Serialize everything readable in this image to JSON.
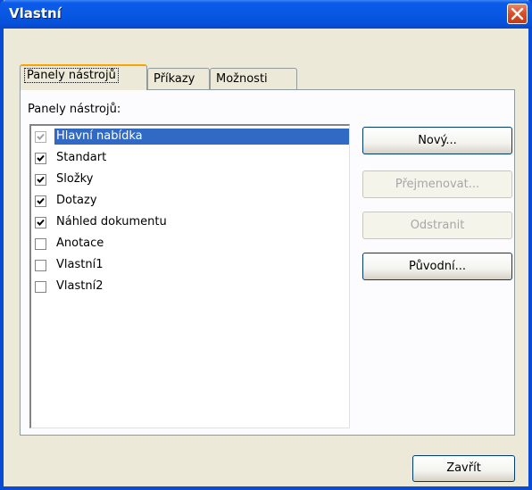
{
  "window": {
    "title": "Vlastní"
  },
  "tabs": [
    {
      "label": "Panely nástrojů",
      "active": true
    },
    {
      "label": "Příkazy",
      "active": false
    },
    {
      "label": "Možnosti",
      "active": false
    }
  ],
  "toolbars": {
    "label": "Panely nástrojů:",
    "items": [
      {
        "label": "Hlavní nabídka",
        "checked": true,
        "disabled": true,
        "selected": true
      },
      {
        "label": "Standart",
        "checked": true
      },
      {
        "label": "Složky",
        "checked": true
      },
      {
        "label": "Dotazy",
        "checked": true
      },
      {
        "label": "Náhled dokumentu",
        "checked": true
      },
      {
        "label": "Anotace",
        "checked": false
      },
      {
        "label": "Vlastní1",
        "checked": false
      },
      {
        "label": "Vlastní2",
        "checked": false
      }
    ]
  },
  "buttons": {
    "new": "Nový...",
    "rename": "Přejmenovat...",
    "delete": "Odstranit",
    "reset": "Původní...",
    "close": "Zavřít"
  },
  "colors": {
    "titlebar": "#0758e3",
    "selection": "#316ac5",
    "tab_highlight": "#f5a400",
    "dialog_bg": "#ece9d8"
  },
  "icons": {
    "close": "close-icon",
    "check": "check-icon"
  }
}
